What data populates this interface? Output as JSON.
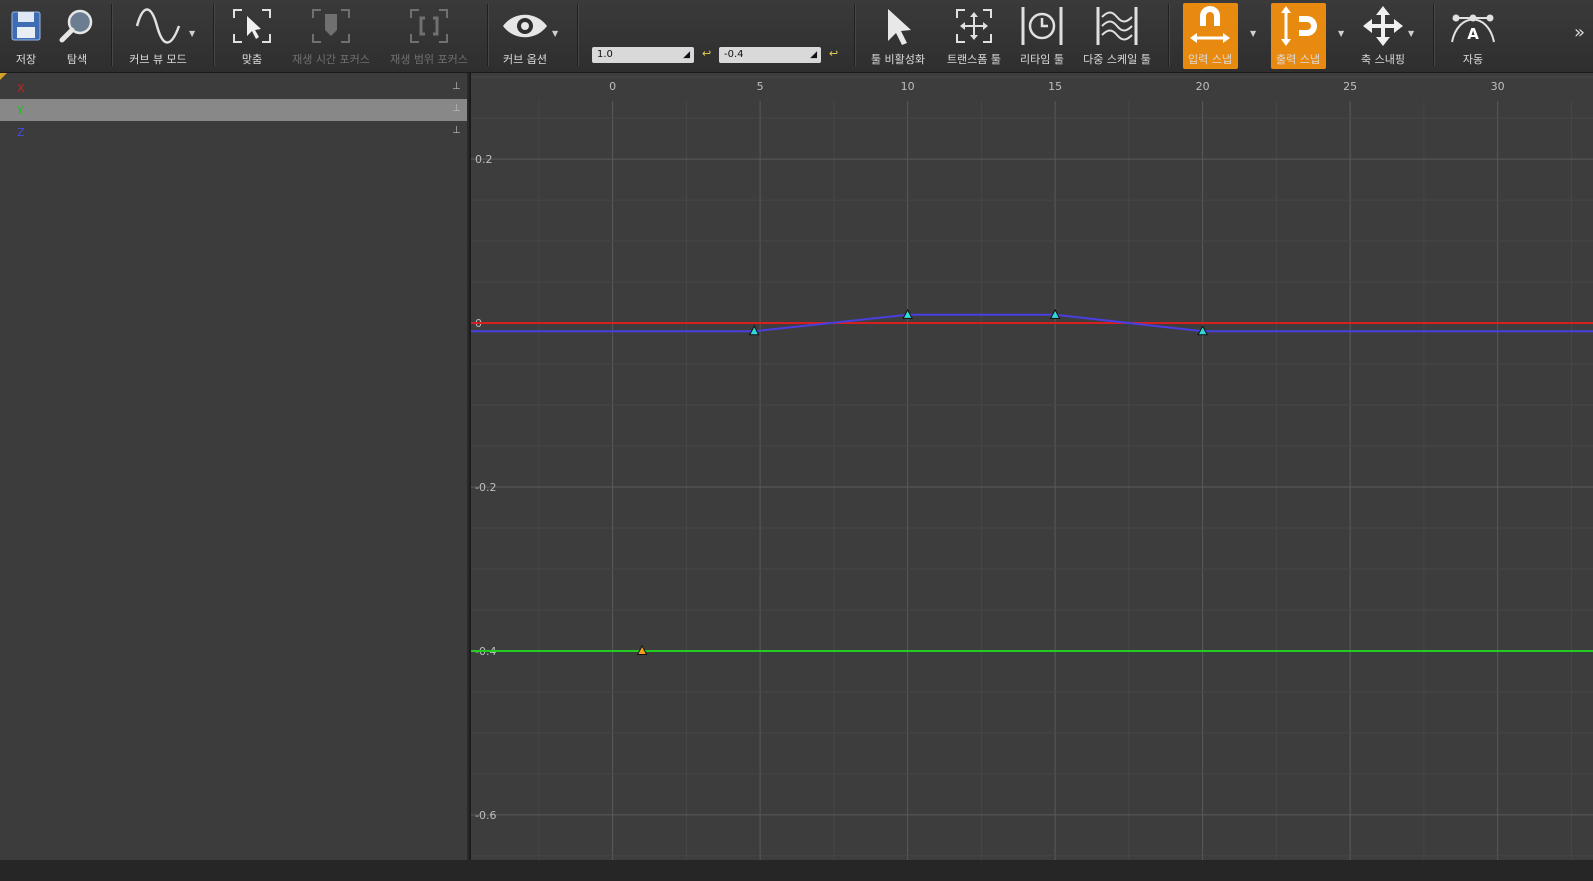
{
  "toolbar": {
    "save_label": "저장",
    "browse_label": "탐색",
    "curve_view_mode_label": "커브 뷰 모드",
    "fit_label": "맞춤",
    "playback_time_focus_label": "재생 시간 포커스",
    "playback_range_focus_label": "재생 범위 포커스",
    "curve_options_label": "커브 옵션",
    "value_field_1": "1.0",
    "value_field_2": "-0.4",
    "tool_disable_label": "툴 비활성화",
    "transform_tool_label": "트랜스폼 툴",
    "retime_tool_label": "리타임 툴",
    "multi_scale_tool_label": "다중 스케일 툴",
    "input_snap_label": "입력 스냅",
    "output_snap_label": "출력 스냅",
    "axis_snapping_label": "축 스내핑",
    "auto_label": "자동",
    "accent_color": "#e88a10"
  },
  "tree": {
    "items": [
      {
        "label": "X",
        "color": "#cc2222",
        "selected": false
      },
      {
        "label": "Y",
        "color": "#22bb22",
        "selected": true
      },
      {
        "label": "Z",
        "color": "#4a4ae0",
        "selected": false
      }
    ]
  },
  "chart_data": {
    "type": "line",
    "x_ticks": [
      "0",
      "5",
      "10",
      "15",
      "20",
      "25",
      "30"
    ],
    "y_ticks": [
      "0.2",
      "0",
      "-0.2",
      "-0.4",
      "-0.6"
    ],
    "xlim": [
      -4.8,
      33.3
    ],
    "ylim": [
      -0.655,
      0.305
    ],
    "series": [
      {
        "name": "X",
        "color": "#d42020",
        "points": [
          [
            -4.8,
            0.0
          ],
          [
            33.3,
            0.0
          ]
        ],
        "keys": []
      },
      {
        "name": "Y",
        "color": "#22cc22",
        "points": [
          [
            -4.8,
            -0.4
          ],
          [
            33.3,
            -0.4
          ]
        ],
        "keys": [
          [
            1.0,
            -0.4
          ]
        ],
        "key_color": "#f0a020"
      },
      {
        "name": "Z",
        "color": "#4a3ee0",
        "points": [
          [
            -4.8,
            -0.01
          ],
          [
            4.8,
            -0.01
          ],
          [
            10.0,
            0.01
          ],
          [
            15.0,
            0.01
          ],
          [
            20.0,
            -0.01
          ],
          [
            33.3,
            -0.01
          ]
        ],
        "keys": [
          [
            4.8,
            -0.01
          ],
          [
            10.0,
            0.01
          ],
          [
            15.0,
            0.01
          ],
          [
            20.0,
            -0.01
          ]
        ],
        "key_color": "#30d8d8"
      }
    ]
  }
}
